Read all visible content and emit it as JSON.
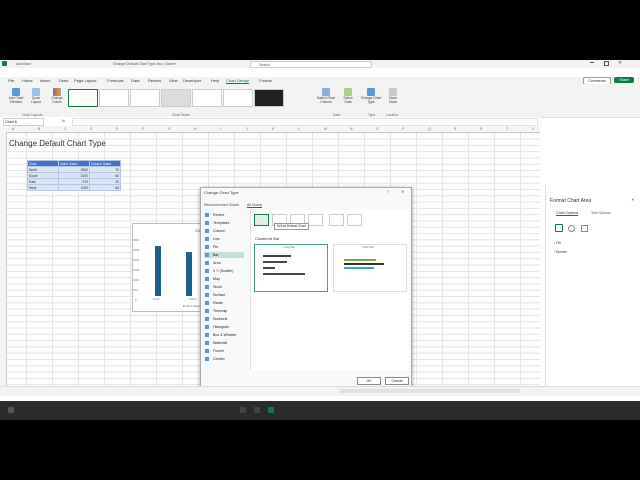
{
  "window": {
    "autosave": "AutoSave",
    "doc_title": "Change Default Chart Type.xlsx • Saved",
    "search_placeholder": "Search"
  },
  "menu": {
    "items": [
      "File",
      "Home",
      "Insert",
      "Draw",
      "Page Layout",
      "Formulas",
      "Data",
      "Review",
      "View",
      "Developer",
      "Help",
      "Chart Design",
      "Format"
    ],
    "active_index": 11,
    "comments": "Comments",
    "share": "Share"
  },
  "ribbon": {
    "buttons": [
      "Add Chart Element",
      "Quick Layout",
      "Change Colors",
      "Switch Row/ Column",
      "Select Data",
      "Change Chart Type",
      "Move Chart"
    ],
    "groups": [
      "Chart Layouts",
      "Chart Styles",
      "Data",
      "Type",
      "Location"
    ]
  },
  "formula": {
    "name_box": "Chart 8",
    "fx": "fx"
  },
  "columns": [
    "A",
    "B",
    "C",
    "D",
    "E",
    "F",
    "G",
    "H",
    "I",
    "J",
    "K",
    "L",
    "M",
    "N",
    "O",
    "P",
    "Q",
    "R",
    "S",
    "T",
    "U"
  ],
  "sheet": {
    "title": "Change Default Chart Type",
    "headers": [
      "Zone",
      "Value Sales",
      "Volume Sales"
    ],
    "rows": [
      [
        "North",
        "2500",
        "70"
      ],
      [
        "South",
        "2200",
        "60"
      ],
      [
        "East",
        "970",
        "20"
      ],
      [
        "West",
        "1000",
        "84"
      ]
    ]
  },
  "chart_bg": {
    "title": "Ch",
    "y_ticks": [
      "3000",
      "2500",
      "2000",
      "1500",
      "1000",
      "500",
      "0"
    ],
    "x_labels": [
      "North",
      "South"
    ],
    "legend": "Value Sales",
    "values": [
      2500,
      2200
    ]
  },
  "dialog": {
    "title": "Change Chart Type",
    "tabs": [
      "Recommended Charts",
      "All Charts"
    ],
    "types": [
      "Recent",
      "Templates",
      "Column",
      "Line",
      "Pie",
      "Bar",
      "Area",
      "X Y (Scatter)",
      "Map",
      "Stock",
      "Surface",
      "Radar",
      "Treemap",
      "Sunburst",
      "Histogram",
      "Box & Whisker",
      "Waterfall",
      "Funnel",
      "Combo"
    ],
    "selected_type_index": 5,
    "tooltip": "Set as Default Chart",
    "subtype_label": "Clustered Bar",
    "preview_title": "Chart Title",
    "ok": "OK",
    "cancel": "Cancel"
  },
  "format_panel": {
    "title": "Format Chart Area",
    "tabs": [
      "Chart Options",
      "Text Options"
    ],
    "sections": [
      "Fill",
      "Border"
    ]
  },
  "colors": {
    "excel_green": "#107c41",
    "bar_blue": "#1f5f8b",
    "accent": "#4472c4"
  }
}
